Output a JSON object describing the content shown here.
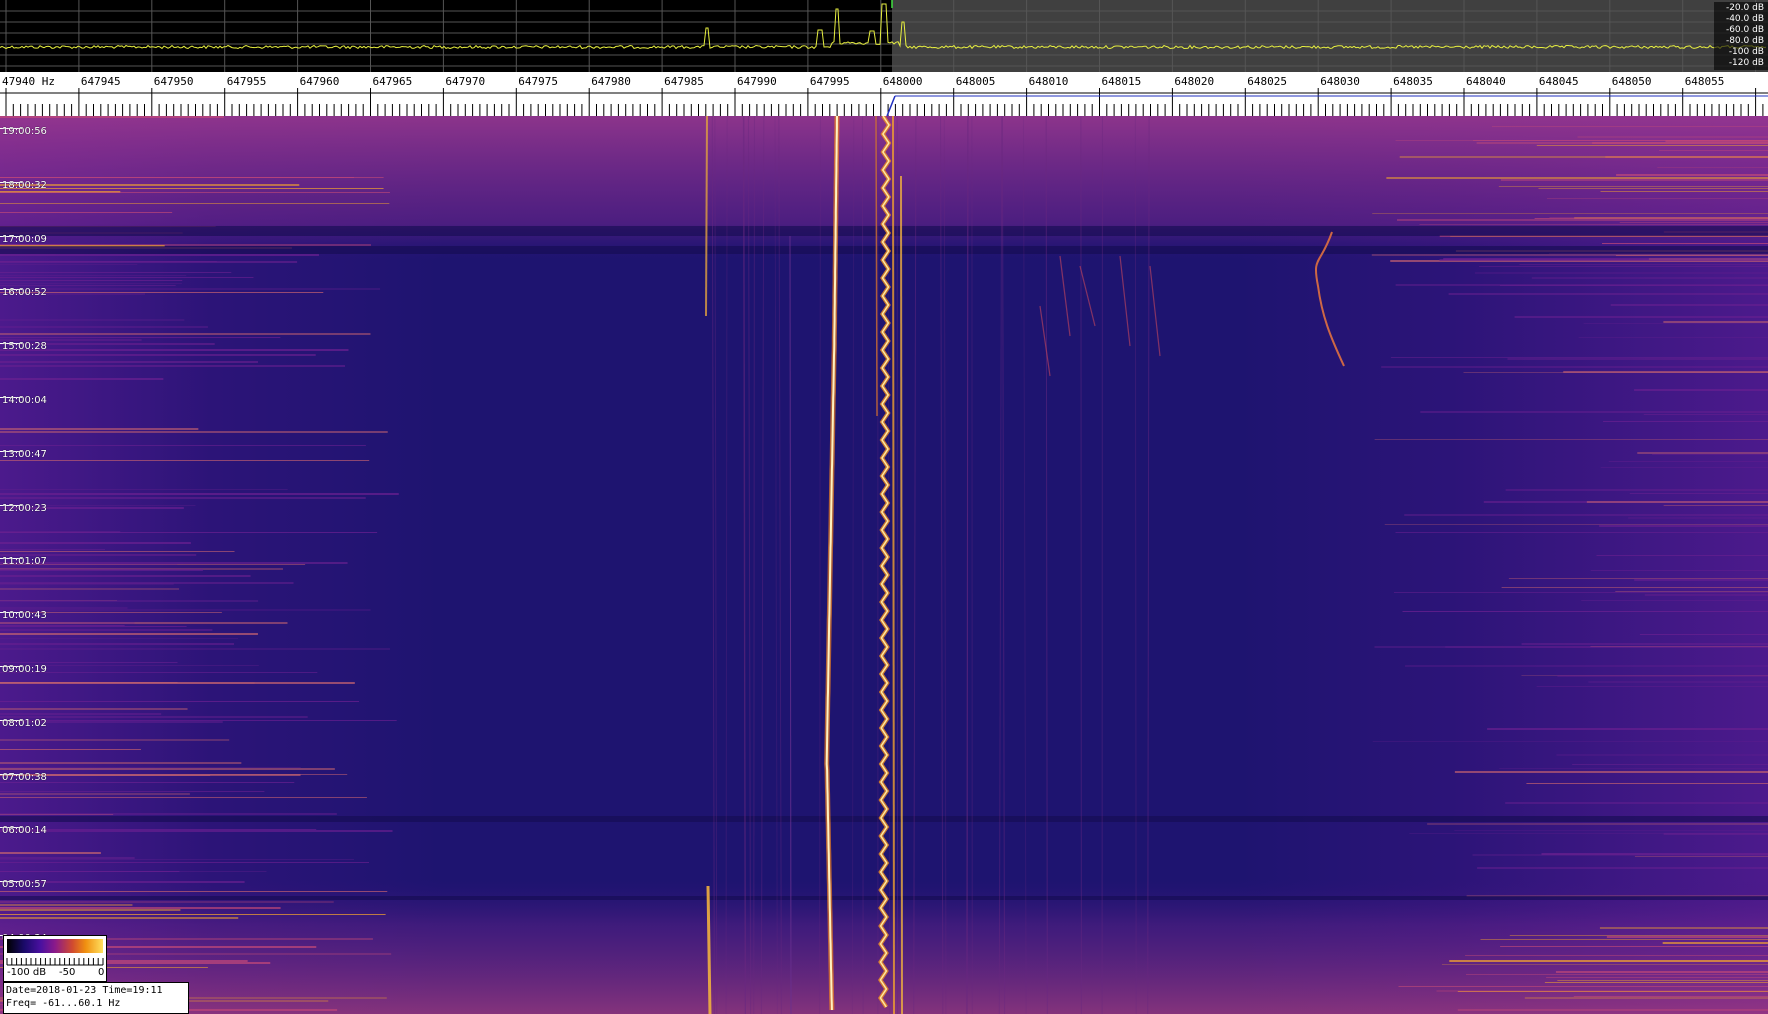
{
  "spectrum": {
    "db_scale": [
      "-20.0 dB",
      "-40.0 dB",
      "-60.0 dB",
      "-80.0 dB",
      "-100 dB",
      "-120 dB"
    ]
  },
  "frequency_axis": {
    "labels": [
      "47940 Hz",
      "647945",
      "647950",
      "647955",
      "647960",
      "647965",
      "647970",
      "647975",
      "647980",
      "647985",
      "647990",
      "647995",
      "648000",
      "648005",
      "648010",
      "648015",
      "648020",
      "648025",
      "648030",
      "648035",
      "648040",
      "648045",
      "648050",
      "648055"
    ]
  },
  "time_axis": {
    "labels": [
      "19:00:56",
      "18:00:32",
      "17:00:09",
      "16:00:52",
      "15:00:28",
      "14:00:04",
      "13:00:47",
      "12:00:23",
      "11:01:07",
      "10:00:43",
      "09:00:19",
      "08:01:02",
      "07:00:38",
      "06:00:14",
      "05:00:57",
      "04:00:34"
    ]
  },
  "colorbar": {
    "labels": [
      "-100 dB",
      "-50",
      "0"
    ]
  },
  "info": {
    "line1": "Date=2018-01-23 Time=19:11",
    "line2": "Freq= -61...60.1 Hz"
  },
  "colors": {
    "background_low": "#1e1470",
    "background_mid": "#3c1488",
    "signal_hot": "#ffd860",
    "signal_warm": "#e06a20",
    "spectrum_trace": "#e8f040",
    "spectrum_grid": "#555555"
  }
}
